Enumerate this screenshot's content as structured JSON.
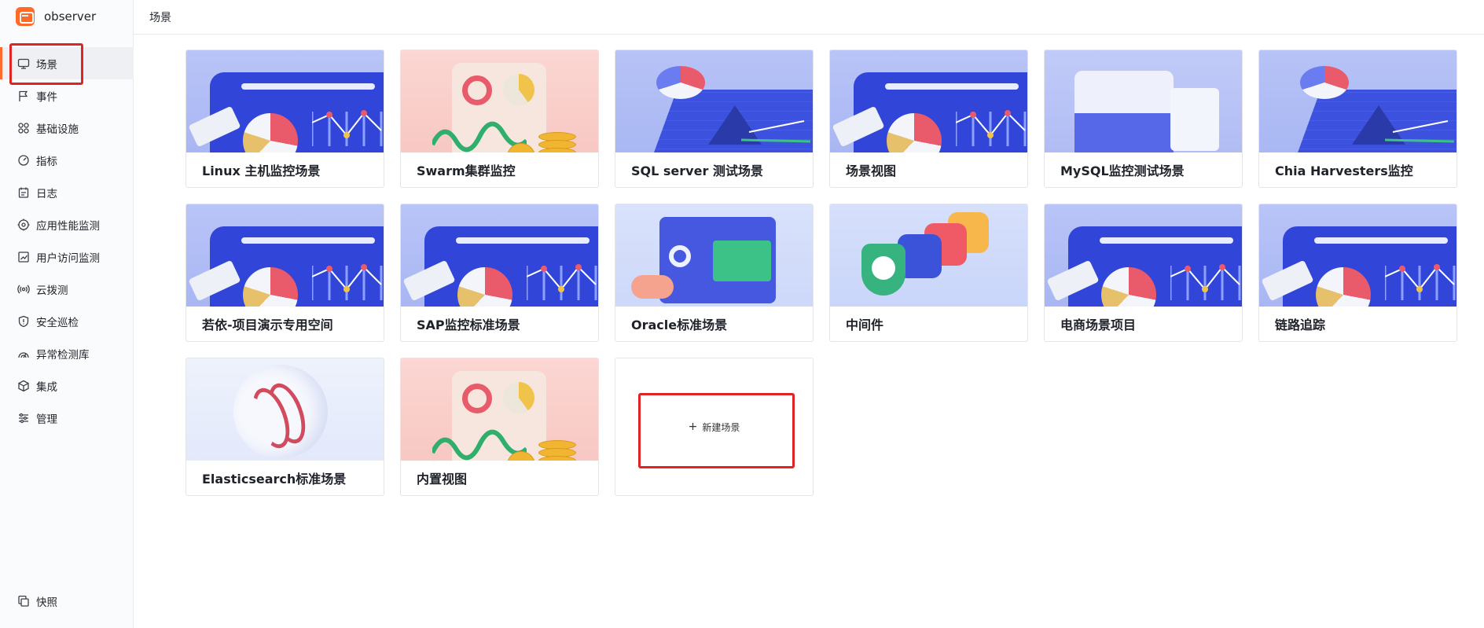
{
  "app": {
    "name": "observer"
  },
  "header": {
    "title": "场景"
  },
  "sidebar": {
    "items": [
      {
        "label": "场景",
        "icon": "monitor-icon"
      },
      {
        "label": "事件",
        "icon": "flag-icon"
      },
      {
        "label": "基础设施",
        "icon": "grid-icon"
      },
      {
        "label": "指标",
        "icon": "gauge-icon"
      },
      {
        "label": "日志",
        "icon": "calendar-icon"
      },
      {
        "label": "应用性能监测",
        "icon": "target-icon"
      },
      {
        "label": "用户访问监测",
        "icon": "chart-icon"
      },
      {
        "label": "云拨测",
        "icon": "signal-icon"
      },
      {
        "label": "安全巡检",
        "icon": "shield-icon"
      },
      {
        "label": "异常检测库",
        "icon": "radar-icon"
      },
      {
        "label": "集成",
        "icon": "cube-icon"
      },
      {
        "label": "管理",
        "icon": "sliders-icon"
      }
    ],
    "bottom": {
      "label": "快照",
      "icon": "copy-icon"
    }
  },
  "scenes": [
    {
      "title": "Linux 主机监控场景",
      "thumb": "dash"
    },
    {
      "title": "Swarm集群监控",
      "thumb": "coin"
    },
    {
      "title": "SQL server 测试场景",
      "thumb": "grid"
    },
    {
      "title": "场景视图",
      "thumb": "dash"
    },
    {
      "title": "MySQL监控测试场景",
      "thumb": "server"
    },
    {
      "title": "Chia Harvesters监控",
      "thumb": "grid"
    },
    {
      "title": "若依-项目演示专用空间",
      "thumb": "dash"
    },
    {
      "title": "SAP监控标准场景",
      "thumb": "dash"
    },
    {
      "title": "Oracle标准场景",
      "thumb": "ui"
    },
    {
      "title": "中间件",
      "thumb": "mid"
    },
    {
      "title": "电商场景项目",
      "thumb": "dash"
    },
    {
      "title": "链路追踪",
      "thumb": "dash"
    },
    {
      "title": "Elasticsearch标准场景",
      "thumb": "elastic"
    },
    {
      "title": "内置视图",
      "thumb": "coin"
    }
  ],
  "new_scene": {
    "plus": "+",
    "label": "新建场景"
  },
  "colors": {
    "accent": "#ff6a2b",
    "highlight": "#e02424"
  }
}
